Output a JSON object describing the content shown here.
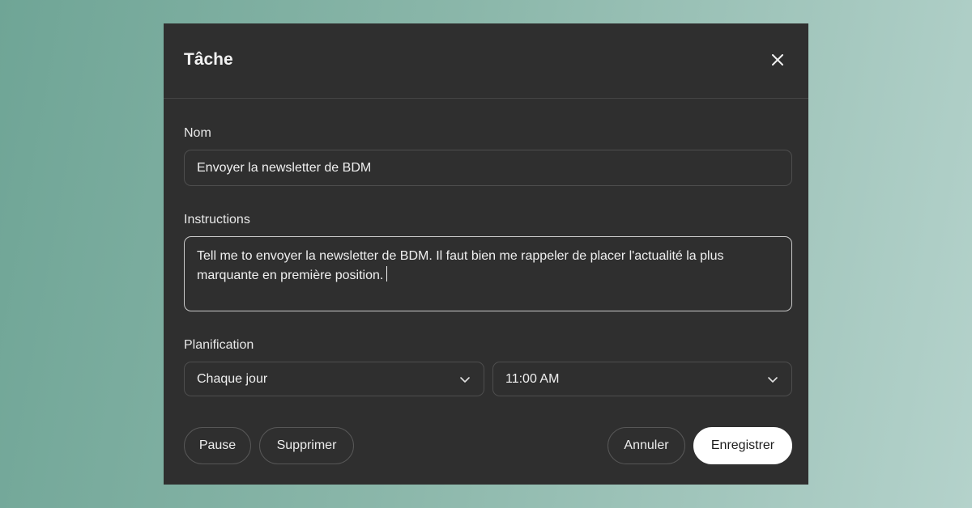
{
  "dialog": {
    "title": "Tâche",
    "close_icon": "close-icon"
  },
  "name_field": {
    "label": "Nom",
    "value": "Envoyer la newsletter de BDM"
  },
  "instructions_field": {
    "label": "Instructions",
    "value": "Tell me to envoyer la newsletter de BDM. Il faut bien me rappeler de placer l'actualité la plus marquante en première position."
  },
  "schedule": {
    "label": "Planification",
    "frequency": "Chaque jour",
    "time": "11:00 AM",
    "dropdown_icon": "chevron-down-icon"
  },
  "buttons": {
    "pause": "Pause",
    "delete": "Supprimer",
    "cancel": "Annuler",
    "save": "Enregistrer"
  },
  "colors": {
    "dialog_bg": "#2f2f2f",
    "primary_button_bg": "#ffffff",
    "background_gradient_start": "#6fa596",
    "background_gradient_end": "#b4d2cb"
  }
}
